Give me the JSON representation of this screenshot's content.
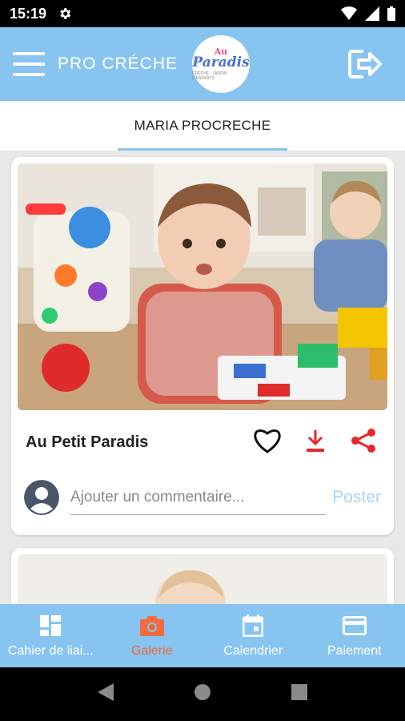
{
  "status": {
    "time": "15:19"
  },
  "app": {
    "title": "PRO CRÉCHE",
    "logo_line1": "Au",
    "logo_line2": "Paradis",
    "logo_line3": "CRÈCHE · JARDIN D'ENFANTS"
  },
  "tabs": [
    {
      "label": "MARIA PROCRECHE",
      "active": true
    }
  ],
  "posts": [
    {
      "title": "Au Petit Paradis",
      "comment_placeholder": "Ajouter un commentaire...",
      "post_label": "Poster"
    }
  ],
  "nav": [
    {
      "label": "Cahier de liai...",
      "icon": "dashboard-icon"
    },
    {
      "label": "Galerie",
      "icon": "camera-icon",
      "active": true
    },
    {
      "label": "Calendrier",
      "icon": "calendar-icon"
    },
    {
      "label": "Paiement",
      "icon": "credit-card-icon"
    }
  ],
  "colors": {
    "primary": "#87c4f0",
    "accent": "#f26a3d",
    "danger": "#e8272b",
    "post_button": "#a8d4f3"
  }
}
